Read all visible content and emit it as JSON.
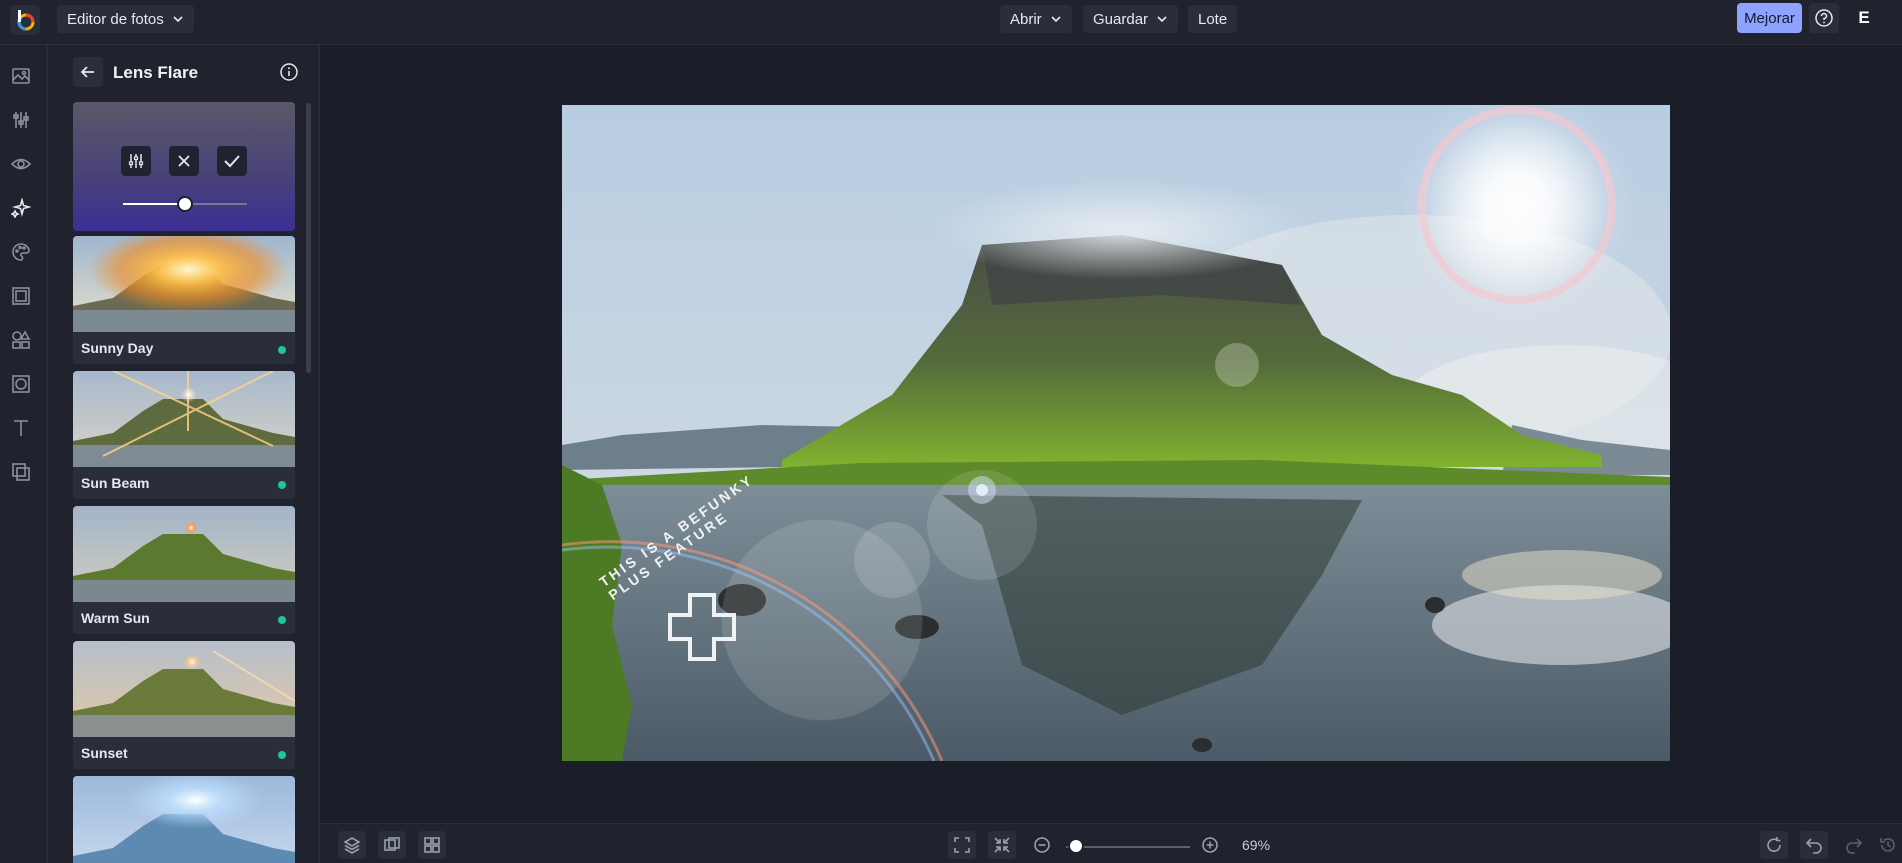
{
  "app": {
    "menu_label": "Editor de fotos",
    "nav": [
      {
        "label": "Abrir"
      },
      {
        "label": "Guardar"
      },
      {
        "label": "Lote"
      }
    ],
    "upgrade_label": "Mejorar",
    "user_initial": "E"
  },
  "panel": {
    "title": "Lens Flare",
    "effects": [
      {
        "label": "Sunny Day",
        "icon": "plus-dot"
      },
      {
        "label": "Sun Beam",
        "icon": "plus-dot"
      },
      {
        "label": "Warm Sun",
        "icon": "plus-dot"
      },
      {
        "label": "Sunset",
        "icon": "plus-dot"
      }
    ]
  },
  "canvas": {
    "watermark_text": "THIS IS A BEFUNKY PLUS FEATURE"
  },
  "zoom": {
    "label": "69%"
  },
  "colors": {
    "accent": "#8ea2ff",
    "plus_dot": "#21c59a",
    "background": "#1b1e28",
    "panel": "#20232e"
  }
}
